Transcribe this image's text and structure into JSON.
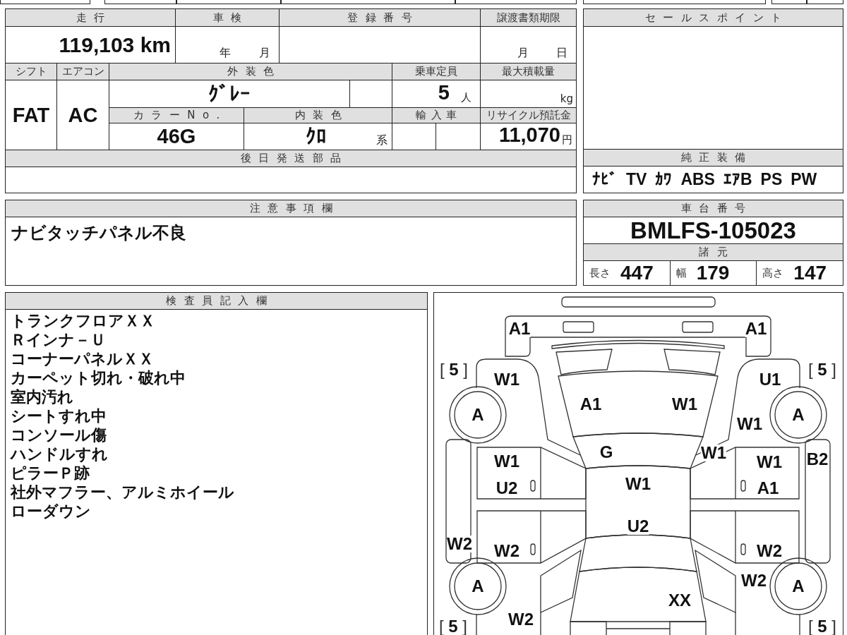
{
  "form": {
    "mileage": {
      "label": "走行",
      "value": "119,103 km"
    },
    "inspection": {
      "label": "車検",
      "year_unit": "年",
      "month_unit": "月"
    },
    "registration": {
      "label": "登録番号"
    },
    "transfer_deadline": {
      "label": "譲渡書類期限",
      "month_unit": "月",
      "day_unit": "日"
    },
    "shift": {
      "label": "シフト",
      "value": "FAT"
    },
    "aircon": {
      "label": "エアコン",
      "value": "AC"
    },
    "exterior_color": {
      "label": "外装色",
      "value": "ｸﾞﾚｰ"
    },
    "capacity": {
      "label": "乗車定員",
      "value": "5",
      "unit": "人"
    },
    "max_load": {
      "label": "最大積載量",
      "unit": "kg"
    },
    "color_no": {
      "label": "カラーNo.",
      "value": "46G"
    },
    "interior_color": {
      "label": "内装色",
      "value": "ｸﾛ",
      "unit": "系"
    },
    "imported": {
      "label": "輸入車"
    },
    "recycle_deposit": {
      "label": "リサイクル預託金",
      "value": "11,070",
      "unit": "円"
    },
    "later_parts": {
      "label": "後日発送部品"
    }
  },
  "sales_points": {
    "label": "セールスポイント"
  },
  "equipment": {
    "label": "純正装備",
    "items": [
      "ﾅﾋﾞ",
      "TV",
      "ｶﾜ",
      "ABS",
      "ｴｱB",
      "PS",
      "PW"
    ]
  },
  "notes": {
    "label": "注意事項欄",
    "text": "ナビタッチパネル不良"
  },
  "chassis": {
    "label": "車台番号",
    "value": "BMLFS-105023"
  },
  "specs": {
    "label": "諸元",
    "items": [
      {
        "label": "長さ",
        "value": "447"
      },
      {
        "label": "幅",
        "value": "179"
      },
      {
        "label": "高さ",
        "value": "147"
      }
    ]
  },
  "inspector": {
    "label": "検査員記入欄",
    "lines": [
      "トランクフロアＸＸ",
      "Ｒインナ－Ｕ",
      "コーナーパネルＸＸ",
      "カーペット切れ・破れ中",
      "室内汚れ",
      "シートすれ中",
      "コンソール傷",
      "ハンドルすれ",
      "ピラーＰ跡",
      "社外マフラー、アルミホイール",
      "ローダウン"
    ]
  },
  "diagram": {
    "tires": {
      "front_left": {
        "tread": "[ **5** ]",
        "code": "A"
      },
      "front_right": {
        "tread": "[ **5** ]",
        "code": "A"
      },
      "rear_left": {
        "tread": "[ **5** ]",
        "code": "A"
      },
      "rear_right": {
        "tread": "[ **5** ]",
        "code": "A"
      }
    },
    "codes": {
      "front_bumper_left": "A1",
      "front_bumper_right": "A1",
      "front_fender_left": "W1",
      "front_fender_right": "U1",
      "hood_left": "A1",
      "hood_right": "W1",
      "front_fender_right_lower": "W1",
      "windshield": "G",
      "pillar_front_right": "W1",
      "front_door_left_upper": "W1",
      "front_door_right_upper": "W1",
      "side_sill_right": "B2",
      "front_door_left_lower": "U2",
      "roof_front": "W1",
      "front_door_right_lower": "A1",
      "roof_rear": "U2",
      "side_sill_left": "W2",
      "rear_door_left": "W2",
      "rear_door_right": "W2",
      "rear_quarter_right": "W2",
      "trunk": "XX",
      "rear_fender_left": "W2"
    }
  }
}
